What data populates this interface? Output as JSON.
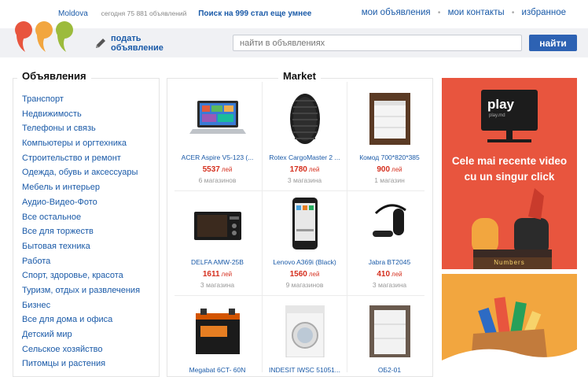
{
  "topbar": {
    "region": "Moldova",
    "stats": "сегодня 75 881 объявлений",
    "promo": "Поиск на 999 стал еще умнее",
    "links": [
      "мои объявления",
      "мои контакты",
      "избранное"
    ]
  },
  "header": {
    "post_ad_line1": "подать",
    "post_ad_line2": "объявление",
    "search_placeholder": "найти в объявлениях",
    "search_button": "найти"
  },
  "categories": {
    "title": "Объявления",
    "items": [
      "Транспорт",
      "Недвижимость",
      "Телефоны и связь",
      "Компьютеры и оргтехника",
      "Строительство и ремонт",
      "Одежда, обувь и аксессуары",
      "Мебель и интерьер",
      "Аудио-Видео-Фото",
      "Все остальное",
      "Все для торжеств",
      "Бытовая техника",
      "Работа",
      "Спорт, здоровье, красота",
      "Туризм, отдых и развлечения",
      "Бизнес",
      "Все для дома и офиса",
      "Детский мир",
      "Сельское хозяйство",
      "Питомцы и растения"
    ]
  },
  "market": {
    "title": "Market",
    "currency": "лей",
    "products": [
      {
        "name": "ACER Aspire V5-123 (...",
        "price": "5537",
        "stores": "6 магазинов",
        "icon": "laptop-icon"
      },
      {
        "name": "Rotex CargoMaster 2 ...",
        "price": "1780",
        "stores": "3 магазина",
        "icon": "tire-icon"
      },
      {
        "name": "Комод 700*820*385",
        "price": "900",
        "stores": "1 магазин",
        "icon": "dresser-icon"
      },
      {
        "name": "DELFA AMW-25B",
        "price": "1611",
        "stores": "3 магазина",
        "icon": "microwave-icon"
      },
      {
        "name": "Lenovo A369i (Black)",
        "price": "1560",
        "stores": "9 магазинов",
        "icon": "phone-icon"
      },
      {
        "name": "Jabra BT2045",
        "price": "410",
        "stores": "3 магазина",
        "icon": "headset-icon"
      },
      {
        "name": "Megabat 6CT- 60N",
        "price": "",
        "stores": "",
        "icon": "battery-icon"
      },
      {
        "name": "INDESIT IWSC 51051...",
        "price": "",
        "stores": "",
        "icon": "washer-icon"
      },
      {
        "name": "ОБ2-01",
        "price": "",
        "stores": "",
        "icon": "cabinet-icon"
      }
    ]
  },
  "ads": {
    "ad1_logo": "play",
    "ad1_logo_sub": "play.md",
    "ad1_text": "Cele mai recente video cu un singur click",
    "ad1_brand": "Numbers",
    "colors": {
      "ad1": "#e8553e",
      "ad2": "#f2a63f",
      "accent": "#2d62b3",
      "price": "#d5301f"
    }
  }
}
